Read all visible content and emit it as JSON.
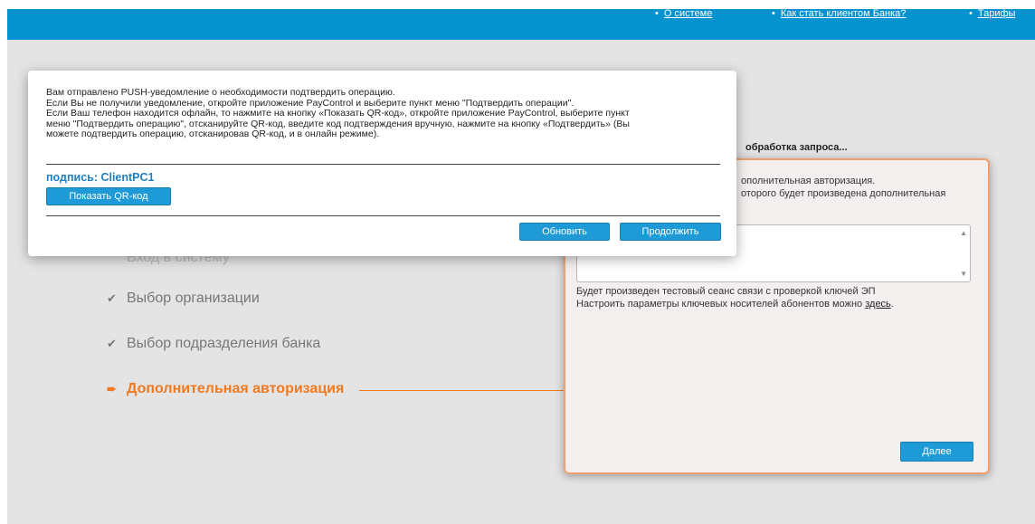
{
  "header": {
    "links": [
      {
        "label": "О системе"
      },
      {
        "label": "Как стать клиентом Банка?"
      },
      {
        "label": "Тарифы"
      }
    ],
    "bullet": "•"
  },
  "steps": [
    {
      "label": "Вход в систему",
      "state": "done"
    },
    {
      "label": "Выбор организации",
      "state": "done"
    },
    {
      "label": "Выбор подразделения банка",
      "state": "done"
    },
    {
      "label": "Дополнительная авторизация",
      "state": "active"
    }
  ],
  "panel": {
    "title_partial": "обработка запроса...",
    "line1_partial": "ополнительная авторизация.",
    "line2_partial": "оторого будет произведена дополнительная",
    "info_line1": "Будет произведен тестовый сеанс связи с проверкой ключей ЭП",
    "info_line2_prefix": "Настроить параметры ключевых носителей абонентов можно ",
    "info_link": "здесь",
    "info_line2_suffix": ".",
    "next_button": "Далее"
  },
  "modal": {
    "message_lines": [
      "Вам отправлено PUSH-уведомление о необходимости подтвердить операцию.",
      "Если Вы не получили уведомление, откройте приложение PayControl и выберите пункт меню \"Подтвердить операции\".",
      "Если Ваш телефон находится офлайн, то нажмите на кнопку «Показать QR-код», откройте приложение PayControl, выберите пункт",
      "меню \"Подтвердить операцию\", отсканируйте QR-код, введите код подтверждения вручную, нажмите на кнопку «Подтвердить» (Вы",
      "можете подтвердить операцию, отсканировав QR-код, и в онлайн режиме)."
    ],
    "signature_label": "подпись: ClientPC1",
    "show_qr_button": "Показать QR-код",
    "refresh_button": "Обновить",
    "continue_button": "Продолжить"
  },
  "colors": {
    "header": "#0592cf",
    "accent_orange": "#f07a20",
    "button_blue": "#1e9ad6",
    "signature_blue": "#1f7fc0"
  },
  "icons": {
    "done": "check-icon",
    "active": "arrow-right-icon"
  }
}
